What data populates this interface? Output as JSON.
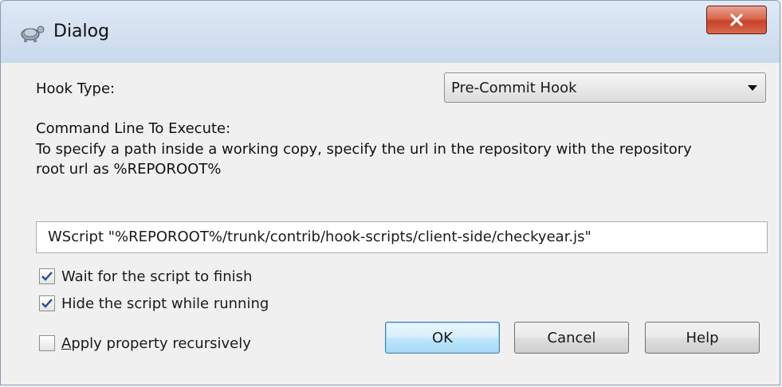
{
  "window": {
    "title": "Dialog",
    "close_icon": "close-x-icon",
    "app_icon": "tortoise-icon"
  },
  "hook_type": {
    "label": "Hook Type:",
    "selected": "Pre-Commit Hook"
  },
  "command": {
    "heading": "Command Line To Execute:",
    "hint_line1": "To specify a path inside a working copy, specify the url in the repository with the repository",
    "hint_line2": "root url as %REPOROOT%",
    "value": "WScript \"%REPOROOT%/trunk/contrib/hook-scripts/client-side/checkyear.js\""
  },
  "options": {
    "wait": {
      "label": "Wait for the script to finish",
      "checked": true
    },
    "hide": {
      "label": "Hide the script while running",
      "checked": true
    },
    "recursive": {
      "label_underlined": "A",
      "label_rest": "pply property recursively",
      "checked": false
    }
  },
  "buttons": {
    "ok": "OK",
    "cancel": "Cancel",
    "help": "Help"
  },
  "colors": {
    "close_button": "#c8422a",
    "default_button_border": "#3c7fb1",
    "check_mark": "#2a4b8d"
  }
}
